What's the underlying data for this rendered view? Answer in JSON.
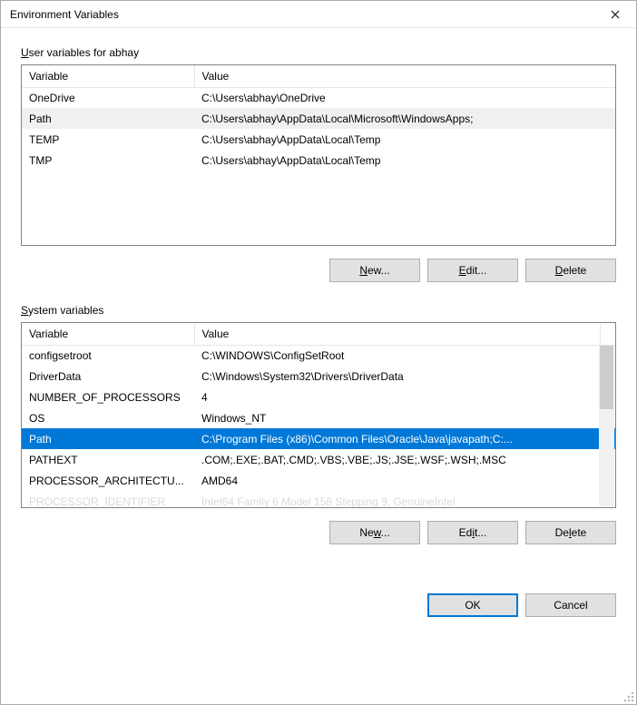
{
  "window": {
    "title": "Environment Variables"
  },
  "sections": {
    "user": {
      "label_prefix": "U",
      "label_rest": "ser variables for abhay",
      "columns": {
        "variable": "Variable",
        "value": "Value"
      },
      "rows": [
        {
          "name": "OneDrive",
          "value": "C:\\Users\\abhay\\OneDrive",
          "selected": false
        },
        {
          "name": "Path",
          "value": "C:\\Users\\abhay\\AppData\\Local\\Microsoft\\WindowsApps;",
          "selected": true
        },
        {
          "name": "TEMP",
          "value": "C:\\Users\\abhay\\AppData\\Local\\Temp",
          "selected": false
        },
        {
          "name": "TMP",
          "value": "C:\\Users\\abhay\\AppData\\Local\\Temp",
          "selected": false
        }
      ],
      "buttons": {
        "new_prefix": "N",
        "new_rest": "ew...",
        "edit_prefix": "E",
        "edit_rest": "dit...",
        "delete_prefix": "D",
        "delete_rest": "elete"
      }
    },
    "system": {
      "label_prefix": "S",
      "label_rest": "ystem variables",
      "columns": {
        "variable": "Variable",
        "value": "Value"
      },
      "rows": [
        {
          "name": "configsetroot",
          "value": "C:\\WINDOWS\\ConfigSetRoot",
          "selected": false
        },
        {
          "name": "DriverData",
          "value": "C:\\Windows\\System32\\Drivers\\DriverData",
          "selected": false
        },
        {
          "name": "NUMBER_OF_PROCESSORS",
          "value": "4",
          "selected": false
        },
        {
          "name": "OS",
          "value": "Windows_NT",
          "selected": false
        },
        {
          "name": "Path",
          "value": "C:\\Program Files (x86)\\Common Files\\Oracle\\Java\\javapath;C:...",
          "selected": true
        },
        {
          "name": "PATHEXT",
          "value": ".COM;.EXE;.BAT;.CMD;.VBS;.VBE;.JS;.JSE;.WSF;.WSH;.MSC",
          "selected": false
        },
        {
          "name": "PROCESSOR_ARCHITECTU...",
          "value": "AMD64",
          "selected": false
        },
        {
          "name": "PROCESSOR_IDENTIFIER",
          "value": "Intel64 Family 6 Model 158 Stepping 9, GenuineIntel",
          "selected": false
        }
      ],
      "buttons": {
        "new_prefix": "w",
        "new_pre": "Ne",
        "new_post": "...",
        "edit_prefix": "i",
        "edit_pre": "Ed",
        "edit_post": "t...",
        "delete_prefix": "l",
        "delete_pre": "De",
        "delete_post": "ete"
      }
    }
  },
  "dialog_buttons": {
    "ok": "OK",
    "cancel": "Cancel"
  }
}
